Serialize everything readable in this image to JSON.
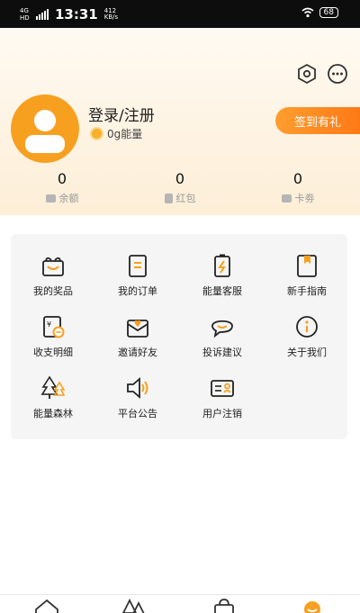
{
  "status_bar": {
    "network": "4G HD",
    "time": "13:31",
    "speed_value": "412",
    "speed_unit": "KB/s",
    "battery": "68"
  },
  "header": {
    "login_text": "登录/注册",
    "energy_text": "0g能量",
    "signin_button": "签到有礼",
    "icons": [
      "hexagon-settings-icon",
      "more-icon"
    ]
  },
  "stats": [
    {
      "value": "0",
      "label": "余额",
      "icon": "wallet-icon"
    },
    {
      "value": "0",
      "label": "红包",
      "icon": "red-envelope-icon"
    },
    {
      "value": "0",
      "label": "卡劵",
      "icon": "coupon-icon"
    }
  ],
  "menu": [
    {
      "label": "我的奖品",
      "icon": "gift-icon"
    },
    {
      "label": "我的订单",
      "icon": "order-icon"
    },
    {
      "label": "能量客服",
      "icon": "battery-service-icon"
    },
    {
      "label": "新手指南",
      "icon": "guide-book-icon"
    },
    {
      "label": "收支明细",
      "icon": "ledger-icon"
    },
    {
      "label": "邀请好友",
      "icon": "invite-envelope-icon"
    },
    {
      "label": "投诉建议",
      "icon": "chat-bubble-icon"
    },
    {
      "label": "关于我们",
      "icon": "info-icon"
    },
    {
      "label": "能量森林",
      "icon": "forest-icon"
    },
    {
      "label": "平台公告",
      "icon": "speaker-icon"
    },
    {
      "label": "用户注销",
      "icon": "id-card-icon"
    }
  ],
  "colors": {
    "accent": "#f7a020",
    "button_start": "#ff9d2e",
    "button_end": "#ff7a16",
    "icon_stroke": "#222222",
    "header_bg": "#fdeed7"
  },
  "tabs": [
    "home-icon",
    "tree-icon",
    "bag-icon",
    "profile-icon"
  ]
}
